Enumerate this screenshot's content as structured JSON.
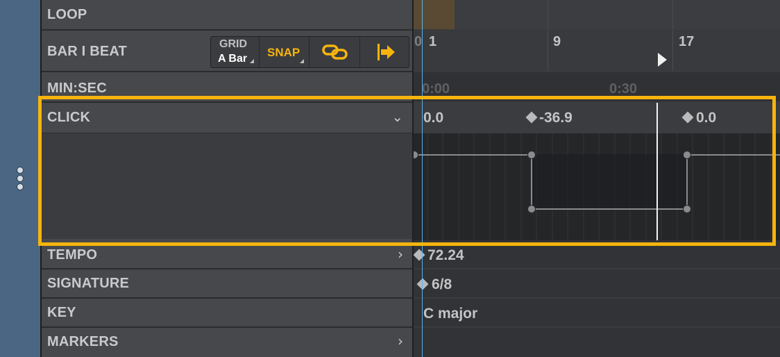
{
  "tracks": {
    "loop": "LOOP",
    "bar_beat": "BAR I BEAT",
    "min_sec": "MIN:SEC",
    "click": "CLICK",
    "tempo": "TEMPO",
    "signature": "SIGNATURE",
    "key": "KEY",
    "markers": "MARKERS"
  },
  "toolbar": {
    "grid_label": "GRID",
    "grid_value": "A Bar",
    "snap_label": "SNAP",
    "link_icon": "link-icon",
    "follow_icon": "arrow-right-bar-icon"
  },
  "ruler": {
    "bars": [
      "0",
      "1",
      "9",
      "17"
    ],
    "times": [
      "0:00",
      "0:30"
    ]
  },
  "click_lane": {
    "values": [
      "0.0",
      "-36.9",
      "0.0"
    ]
  },
  "tempo_lane": {
    "value": "72.24"
  },
  "signature_lane": {
    "value": "6/8"
  },
  "key_lane": {
    "value": "C major"
  },
  "colors": {
    "accent": "#f6b40e",
    "playhead": "#5ab3e6",
    "sidebar": "#4a6683",
    "loop_region": "#5a4a33"
  }
}
